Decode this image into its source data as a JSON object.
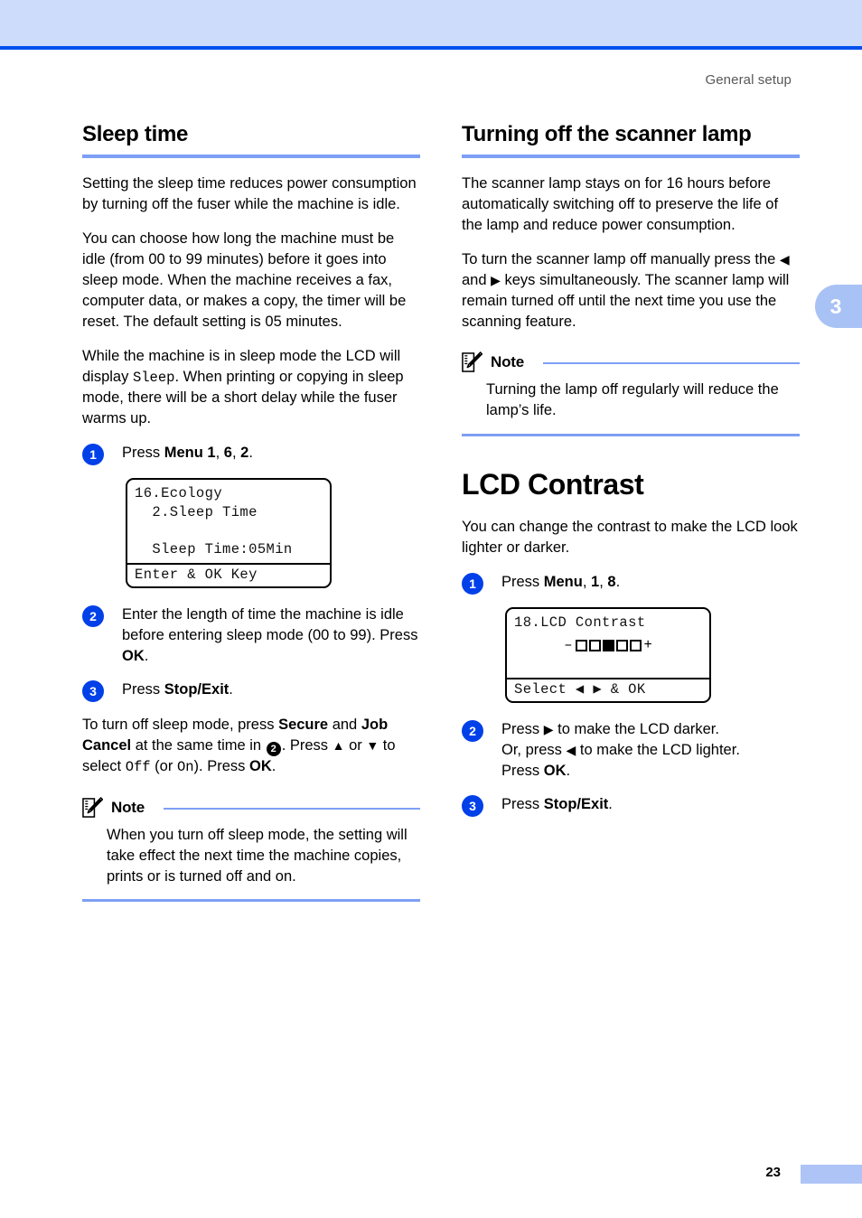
{
  "page": {
    "running_head": "General setup",
    "chapter_tab": "3",
    "page_number": "23"
  },
  "colors": {
    "band": "#cedcfb",
    "rule": "#0050ee",
    "heading_underline": "#7d9ff4",
    "step_circle": "#0040e8",
    "tab": "#a9c2f5"
  },
  "left_column": {
    "heading": "Sleep time",
    "paragraphs": [
      "Setting the sleep time reduces power consumption by turning off the fuser while the machine is idle.",
      "You can choose how long the machine must be idle (from 00 to 99 minutes) before it goes into sleep mode. When the machine receives a fax, computer data, or makes a copy, the timer will be reset. The default setting is 05 minutes."
    ],
    "paragraph_sleep": {
      "before": "While the machine is in sleep mode the LCD will display ",
      "mono": "Sleep",
      "after": ". When printing or copying in sleep mode, there will be a short delay while the fuser warms up."
    },
    "steps": [
      {
        "num": "1",
        "text_parts": [
          "Press ",
          "Menu 1",
          ", ",
          "6",
          ", ",
          "2",
          "."
        ]
      },
      {
        "num": "2",
        "text_before": "Enter the length of time the machine is idle before entering sleep mode (00 to 99). Press ",
        "bold": "OK",
        "text_after": "."
      },
      {
        "num": "3",
        "text_before": "Press ",
        "bold": "Stop/Exit",
        "text_after": "."
      }
    ],
    "lcd": {
      "line1": "16.Ecology",
      "line2": "  2.Sleep Time",
      "line3": "",
      "line4": "  Sleep Time:05Min",
      "footer": "Enter & OK Key"
    },
    "turn_off_paragraph": {
      "p1": "To turn off sleep mode, press ",
      "b1": "Secure",
      "p2": " and ",
      "b2": "Job Cancel",
      "p3": " at the same time in ",
      "circ": "2",
      "p4": ". Press ",
      "up": "▲",
      "p5": " or ",
      "down": "▼",
      "p6": " to select ",
      "m1": "Off",
      "p7": " (or ",
      "m2": "On",
      "p8": "). Press ",
      "b3": "OK",
      "p9": "."
    },
    "note": {
      "title": "Note",
      "body": "When you turn off sleep mode, the setting will take effect the next time the machine copies, prints or is turned off and on."
    }
  },
  "right_column": {
    "heading": "Turning off the scanner lamp",
    "paragraph1": "The scanner lamp stays on for 16 hours before automatically switching off to preserve the life of the lamp and reduce power consumption.",
    "paragraph2": {
      "p1": "To turn the scanner lamp off manually press the ",
      "left": "◀",
      "p2": " and ",
      "right": "▶",
      "p3": " keys simultaneously. The scanner lamp will remain turned off until the next time you use the scanning feature."
    },
    "note": {
      "title": "Note",
      "body": "Turning the lamp off regularly will reduce the lamp’s life."
    },
    "chapter_heading": "LCD Contrast",
    "intro": "You can change the contrast to make the LCD look lighter or darker.",
    "steps": [
      {
        "num": "1",
        "p1": "Press ",
        "b1": "Menu",
        "p2": ", ",
        "b2": "1",
        "p3": ", ",
        "b3": "8",
        "p4": "."
      },
      {
        "num": "2",
        "p1": "Press ",
        "right": "▶",
        "p2": " to make the LCD darker.",
        "l1": "Or, press ",
        "left": "◀",
        "l2": " to make the LCD lighter.",
        "l3": "Press ",
        "b1": "OK",
        "l4": "."
      },
      {
        "num": "3",
        "p1": "Press ",
        "b1": "Stop/Exit",
        "p2": "."
      }
    ],
    "lcd": {
      "line1": "18.LCD Contrast",
      "gauge": {
        "minus": "–",
        "plus": "+",
        "boxes": [
          false,
          false,
          true,
          false,
          false
        ]
      },
      "footer": "Select ◀ ▶ & OK"
    }
  }
}
